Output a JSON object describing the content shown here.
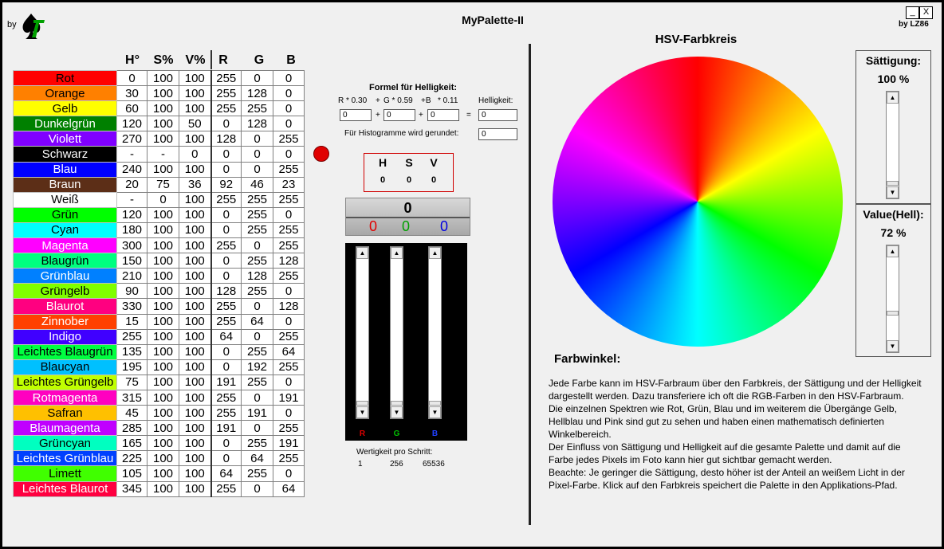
{
  "window": {
    "by": "by",
    "title": "MyPalette-II",
    "min": "_",
    "close": "X",
    "author": "by LZ86"
  },
  "headers": [
    "H°",
    "S%",
    "V%",
    "R",
    "G",
    "B"
  ],
  "colors": [
    {
      "name": "Rot",
      "bg": "#ff0000",
      "fg": "#000000",
      "v": [
        "0",
        "100",
        "100",
        "255",
        "0",
        "0"
      ]
    },
    {
      "name": "Orange",
      "bg": "#ff8000",
      "fg": "#000000",
      "v": [
        "30",
        "100",
        "100",
        "255",
        "128",
        "0"
      ]
    },
    {
      "name": "Gelb",
      "bg": "#ffff00",
      "fg": "#000000",
      "v": [
        "60",
        "100",
        "100",
        "255",
        "255",
        "0"
      ]
    },
    {
      "name": "Dunkelgrün",
      "bg": "#008000",
      "fg": "#ffffff",
      "v": [
        "120",
        "100",
        "50",
        "0",
        "128",
        "0"
      ]
    },
    {
      "name": "Violett",
      "bg": "#8000ff",
      "fg": "#ffffff",
      "v": [
        "270",
        "100",
        "100",
        "128",
        "0",
        "255"
      ]
    },
    {
      "name": "Schwarz",
      "bg": "#000000",
      "fg": "#ffffff",
      "v": [
        "-",
        "-",
        "0",
        "0",
        "0",
        "0"
      ]
    },
    {
      "name": "Blau",
      "bg": "#0000ff",
      "fg": "#ffffff",
      "v": [
        "240",
        "100",
        "100",
        "0",
        "0",
        "255"
      ]
    },
    {
      "name": "Braun",
      "bg": "#5c2e17",
      "fg": "#ffffff",
      "v": [
        "20",
        "75",
        "36",
        "92",
        "46",
        "23"
      ]
    },
    {
      "name": "Weiß",
      "bg": "#ffffff",
      "fg": "#000000",
      "v": [
        "-",
        "0",
        "100",
        "255",
        "255",
        "255"
      ]
    },
    {
      "name": "Grün",
      "bg": "#00ff00",
      "fg": "#000000",
      "v": [
        "120",
        "100",
        "100",
        "0",
        "255",
        "0"
      ]
    },
    {
      "name": "Cyan",
      "bg": "#00ffff",
      "fg": "#000000",
      "v": [
        "180",
        "100",
        "100",
        "0",
        "255",
        "255"
      ]
    },
    {
      "name": "Magenta",
      "bg": "#ff00ff",
      "fg": "#ffffff",
      "v": [
        "300",
        "100",
        "100",
        "255",
        "0",
        "255"
      ]
    },
    {
      "name": "Blaugrün",
      "bg": "#00ff80",
      "fg": "#000000",
      "v": [
        "150",
        "100",
        "100",
        "0",
        "255",
        "128"
      ]
    },
    {
      "name": "Grünblau",
      "bg": "#0080ff",
      "fg": "#ffffff",
      "v": [
        "210",
        "100",
        "100",
        "0",
        "128",
        "255"
      ]
    },
    {
      "name": "Grüngelb",
      "bg": "#80ff00",
      "fg": "#000000",
      "v": [
        "90",
        "100",
        "100",
        "128",
        "255",
        "0"
      ]
    },
    {
      "name": "Blaurot",
      "bg": "#ff0080",
      "fg": "#ffffff",
      "v": [
        "330",
        "100",
        "100",
        "255",
        "0",
        "128"
      ]
    },
    {
      "name": "Zinnober",
      "bg": "#ff4000",
      "fg": "#ffffff",
      "v": [
        "15",
        "100",
        "100",
        "255",
        "64",
        "0"
      ]
    },
    {
      "name": "Indigo",
      "bg": "#4000ff",
      "fg": "#ffffff",
      "v": [
        "255",
        "100",
        "100",
        "64",
        "0",
        "255"
      ]
    },
    {
      "name": "Leichtes Blaugrün",
      "bg": "#00ff40",
      "fg": "#000000",
      "v": [
        "135",
        "100",
        "100",
        "0",
        "255",
        "64"
      ]
    },
    {
      "name": "Blaucyan",
      "bg": "#00c0ff",
      "fg": "#000000",
      "v": [
        "195",
        "100",
        "100",
        "0",
        "192",
        "255"
      ]
    },
    {
      "name": "Leichtes Grüngelb",
      "bg": "#c0ff00",
      "fg": "#000000",
      "v": [
        "75",
        "100",
        "100",
        "191",
        "255",
        "0"
      ]
    },
    {
      "name": "Rotmagenta",
      "bg": "#ff00c0",
      "fg": "#ffffff",
      "v": [
        "315",
        "100",
        "100",
        "255",
        "0",
        "191"
      ]
    },
    {
      "name": "Safran",
      "bg": "#ffc000",
      "fg": "#000000",
      "v": [
        "45",
        "100",
        "100",
        "255",
        "191",
        "0"
      ]
    },
    {
      "name": "Blaumagenta",
      "bg": "#c000ff",
      "fg": "#ffffff",
      "v": [
        "285",
        "100",
        "100",
        "191",
        "0",
        "255"
      ]
    },
    {
      "name": "Grüncyan",
      "bg": "#00ffc0",
      "fg": "#000000",
      "v": [
        "165",
        "100",
        "100",
        "0",
        "255",
        "191"
      ]
    },
    {
      "name": "Leichtes Grünblau",
      "bg": "#0040ff",
      "fg": "#ffffff",
      "v": [
        "225",
        "100",
        "100",
        "0",
        "64",
        "255"
      ]
    },
    {
      "name": "Limett",
      "bg": "#40ff00",
      "fg": "#000000",
      "v": [
        "105",
        "100",
        "100",
        "64",
        "255",
        "0"
      ]
    },
    {
      "name": "Leichtes Blaurot",
      "bg": "#ff0040",
      "fg": "#ffffff",
      "v": [
        "345",
        "100",
        "100",
        "255",
        "0",
        "64"
      ]
    }
  ],
  "formula": {
    "title": "Formel für Helligkeit:",
    "r": "R * 0.30",
    "plus1": "+",
    "g": "G * 0.59",
    "plus2": "+B",
    "b": "* 0.11",
    "hlabel": "Helligkeit:",
    "r_val": "0",
    "g_val": "0",
    "b_val": "0",
    "h_val": "0",
    "plus_a": "+",
    "plus_b": "+",
    "eq": "=",
    "hist_label": "Für Histogramme wird gerundet:",
    "hist_val": "0"
  },
  "hsv": {
    "h_label": "H",
    "s_label": "S",
    "v_label": "V",
    "h": "0",
    "s": "0",
    "v": "0"
  },
  "display": {
    "value": "0",
    "r": "0",
    "g": "0",
    "b": "0"
  },
  "sliders": {
    "r_label": "R",
    "g_label": "G",
    "b_label": "B"
  },
  "wertigkeit": {
    "label": "Wertigkeit pro Schritt:",
    "v1": "1",
    "v2": "256",
    "v3": "65536"
  },
  "wheel": {
    "title": "HSV-Farbkreis"
  },
  "saturation": {
    "label": "Sättigung:",
    "value": "100 %"
  },
  "value": {
    "label": "Value(Hell):",
    "value": "72 %"
  },
  "farbwinkel": "Farbwinkel:",
  "description": [
    "Jede Farbe kann im HSV-Farbraum über den Farbkreis, der Sättigung und der Helligkeit dargestellt werden. Dazu transferiere ich oft die RGB-Farben in den HSV-Farbraum.",
    "Die einzelnen Spektren wie Rot, Grün, Blau und im weiterem die Übergänge Gelb, Hellblau und Pink sind gut zu sehen und haben einen mathematisch definierten Winkelbereich.",
    "Der Einfluss von Sättigung und Helligkeit auf die gesamte Palette und damit auf die Farbe jedes Pixels im Foto kann hier gut sichtbar gemacht werden.",
    "Beachte: Je geringer die Sättigung, desto höher ist der Anteil an weißem Licht in der Pixel-Farbe. Klick auf den Farbkreis speichert die Palette in den Applikations-Pfad."
  ]
}
